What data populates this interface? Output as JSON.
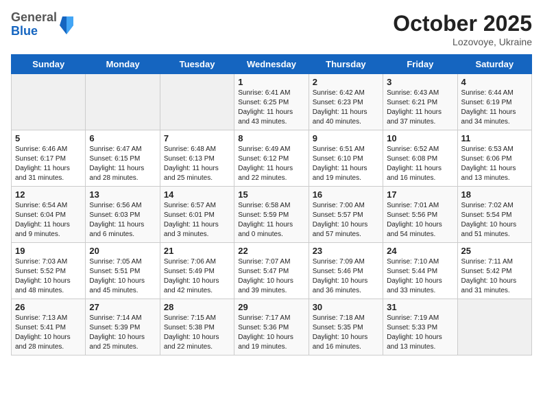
{
  "header": {
    "logo_general": "General",
    "logo_blue": "Blue",
    "month_title": "October 2025",
    "location": "Lozovoye, Ukraine"
  },
  "days_of_week": [
    "Sunday",
    "Monday",
    "Tuesday",
    "Wednesday",
    "Thursday",
    "Friday",
    "Saturday"
  ],
  "weeks": [
    [
      {
        "day": "",
        "info": ""
      },
      {
        "day": "",
        "info": ""
      },
      {
        "day": "",
        "info": ""
      },
      {
        "day": "1",
        "info": "Sunrise: 6:41 AM\nSunset: 6:25 PM\nDaylight: 11 hours\nand 43 minutes."
      },
      {
        "day": "2",
        "info": "Sunrise: 6:42 AM\nSunset: 6:23 PM\nDaylight: 11 hours\nand 40 minutes."
      },
      {
        "day": "3",
        "info": "Sunrise: 6:43 AM\nSunset: 6:21 PM\nDaylight: 11 hours\nand 37 minutes."
      },
      {
        "day": "4",
        "info": "Sunrise: 6:44 AM\nSunset: 6:19 PM\nDaylight: 11 hours\nand 34 minutes."
      }
    ],
    [
      {
        "day": "5",
        "info": "Sunrise: 6:46 AM\nSunset: 6:17 PM\nDaylight: 11 hours\nand 31 minutes."
      },
      {
        "day": "6",
        "info": "Sunrise: 6:47 AM\nSunset: 6:15 PM\nDaylight: 11 hours\nand 28 minutes."
      },
      {
        "day": "7",
        "info": "Sunrise: 6:48 AM\nSunset: 6:13 PM\nDaylight: 11 hours\nand 25 minutes."
      },
      {
        "day": "8",
        "info": "Sunrise: 6:49 AM\nSunset: 6:12 PM\nDaylight: 11 hours\nand 22 minutes."
      },
      {
        "day": "9",
        "info": "Sunrise: 6:51 AM\nSunset: 6:10 PM\nDaylight: 11 hours\nand 19 minutes."
      },
      {
        "day": "10",
        "info": "Sunrise: 6:52 AM\nSunset: 6:08 PM\nDaylight: 11 hours\nand 16 minutes."
      },
      {
        "day": "11",
        "info": "Sunrise: 6:53 AM\nSunset: 6:06 PM\nDaylight: 11 hours\nand 13 minutes."
      }
    ],
    [
      {
        "day": "12",
        "info": "Sunrise: 6:54 AM\nSunset: 6:04 PM\nDaylight: 11 hours\nand 9 minutes."
      },
      {
        "day": "13",
        "info": "Sunrise: 6:56 AM\nSunset: 6:03 PM\nDaylight: 11 hours\nand 6 minutes."
      },
      {
        "day": "14",
        "info": "Sunrise: 6:57 AM\nSunset: 6:01 PM\nDaylight: 11 hours\nand 3 minutes."
      },
      {
        "day": "15",
        "info": "Sunrise: 6:58 AM\nSunset: 5:59 PM\nDaylight: 11 hours\nand 0 minutes."
      },
      {
        "day": "16",
        "info": "Sunrise: 7:00 AM\nSunset: 5:57 PM\nDaylight: 10 hours\nand 57 minutes."
      },
      {
        "day": "17",
        "info": "Sunrise: 7:01 AM\nSunset: 5:56 PM\nDaylight: 10 hours\nand 54 minutes."
      },
      {
        "day": "18",
        "info": "Sunrise: 7:02 AM\nSunset: 5:54 PM\nDaylight: 10 hours\nand 51 minutes."
      }
    ],
    [
      {
        "day": "19",
        "info": "Sunrise: 7:03 AM\nSunset: 5:52 PM\nDaylight: 10 hours\nand 48 minutes."
      },
      {
        "day": "20",
        "info": "Sunrise: 7:05 AM\nSunset: 5:51 PM\nDaylight: 10 hours\nand 45 minutes."
      },
      {
        "day": "21",
        "info": "Sunrise: 7:06 AM\nSunset: 5:49 PM\nDaylight: 10 hours\nand 42 minutes."
      },
      {
        "day": "22",
        "info": "Sunrise: 7:07 AM\nSunset: 5:47 PM\nDaylight: 10 hours\nand 39 minutes."
      },
      {
        "day": "23",
        "info": "Sunrise: 7:09 AM\nSunset: 5:46 PM\nDaylight: 10 hours\nand 36 minutes."
      },
      {
        "day": "24",
        "info": "Sunrise: 7:10 AM\nSunset: 5:44 PM\nDaylight: 10 hours\nand 33 minutes."
      },
      {
        "day": "25",
        "info": "Sunrise: 7:11 AM\nSunset: 5:42 PM\nDaylight: 10 hours\nand 31 minutes."
      }
    ],
    [
      {
        "day": "26",
        "info": "Sunrise: 7:13 AM\nSunset: 5:41 PM\nDaylight: 10 hours\nand 28 minutes."
      },
      {
        "day": "27",
        "info": "Sunrise: 7:14 AM\nSunset: 5:39 PM\nDaylight: 10 hours\nand 25 minutes."
      },
      {
        "day": "28",
        "info": "Sunrise: 7:15 AM\nSunset: 5:38 PM\nDaylight: 10 hours\nand 22 minutes."
      },
      {
        "day": "29",
        "info": "Sunrise: 7:17 AM\nSunset: 5:36 PM\nDaylight: 10 hours\nand 19 minutes."
      },
      {
        "day": "30",
        "info": "Sunrise: 7:18 AM\nSunset: 5:35 PM\nDaylight: 10 hours\nand 16 minutes."
      },
      {
        "day": "31",
        "info": "Sunrise: 7:19 AM\nSunset: 5:33 PM\nDaylight: 10 hours\nand 13 minutes."
      },
      {
        "day": "",
        "info": ""
      }
    ]
  ]
}
